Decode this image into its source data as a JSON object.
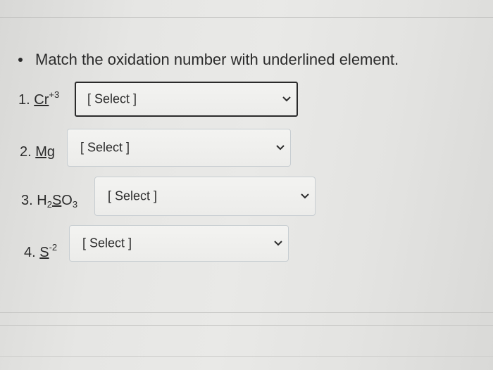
{
  "instruction": "Match the oxidation number with underlined element.",
  "questions": [
    {
      "number": "1.",
      "element": "Cr",
      "sup": "+3",
      "select": "[ Select ]"
    },
    {
      "number": "2.",
      "element": "Mg",
      "select": "[ Select ]"
    },
    {
      "number": "3.",
      "pre": "H",
      "sub1": "2",
      "element": "S",
      "post": "O",
      "sub2": "3",
      "select": "[ Select ]"
    },
    {
      "number": "4.",
      "element": "S",
      "sup": "-2",
      "select": "[ Select ]"
    }
  ],
  "icons": {
    "chevron": "chevron-down-icon"
  },
  "colors": {
    "focus_border": "#2b2b2b",
    "select_border": "#c7cdd1"
  }
}
